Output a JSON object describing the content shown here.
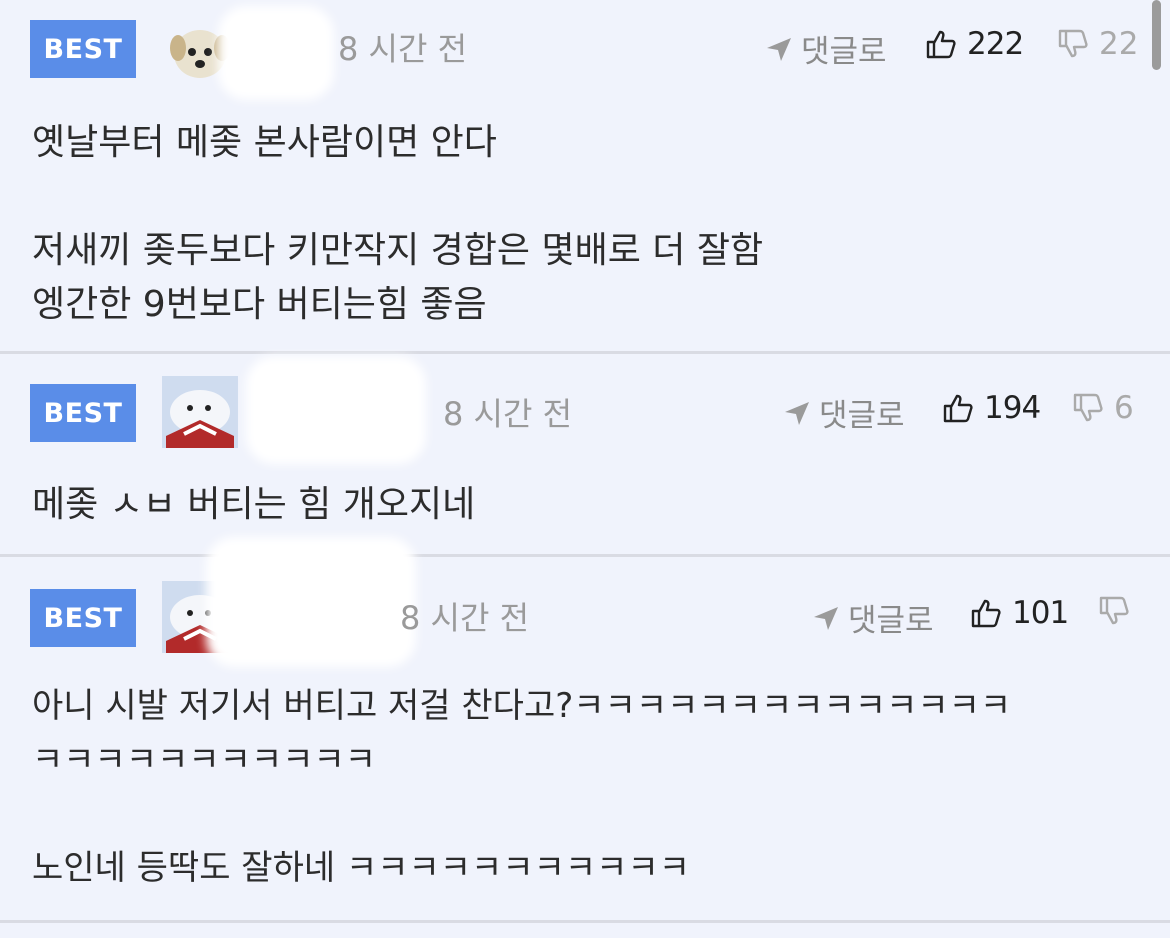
{
  "comments": [
    {
      "badge": "BEST",
      "time": "8 시간 전",
      "reply_label": "댓글로",
      "likes": "222",
      "dislikes": "22",
      "body": "옛날부터 메좆 본사람이면 안다\n\n저새끼 좆두보다 키만작지 경합은 몇배로 더 잘함\n엥간한 9번보다 버티는힘 좋음"
    },
    {
      "badge": "BEST",
      "time": "8 시간 전",
      "reply_label": "댓글로",
      "likes": "194",
      "dislikes": "6",
      "body": "메좆 ㅅㅂ 버티는 힘 개오지네"
    },
    {
      "badge": "BEST",
      "time": "8 시간 전",
      "reply_label": "댓글로",
      "likes": "101",
      "dislikes": "",
      "body": "아니 시발 저기서 버티고 저걸 찬다고?ㅋㅋㅋㅋㅋㅋㅋㅋㅋㅋㅋㅋㅋㅋ\nㅋㅋㅋㅋㅋㅋㅋㅋㅋㅋㅋ\n\n노인네 등딱도 잘하네 ㅋㅋㅋㅋㅋㅋㅋㅋㅋㅋㅋ"
    }
  ],
  "colors": {
    "badge": "#5a8de8",
    "background": "#f0f3fc",
    "divider": "#d9dbe3"
  }
}
